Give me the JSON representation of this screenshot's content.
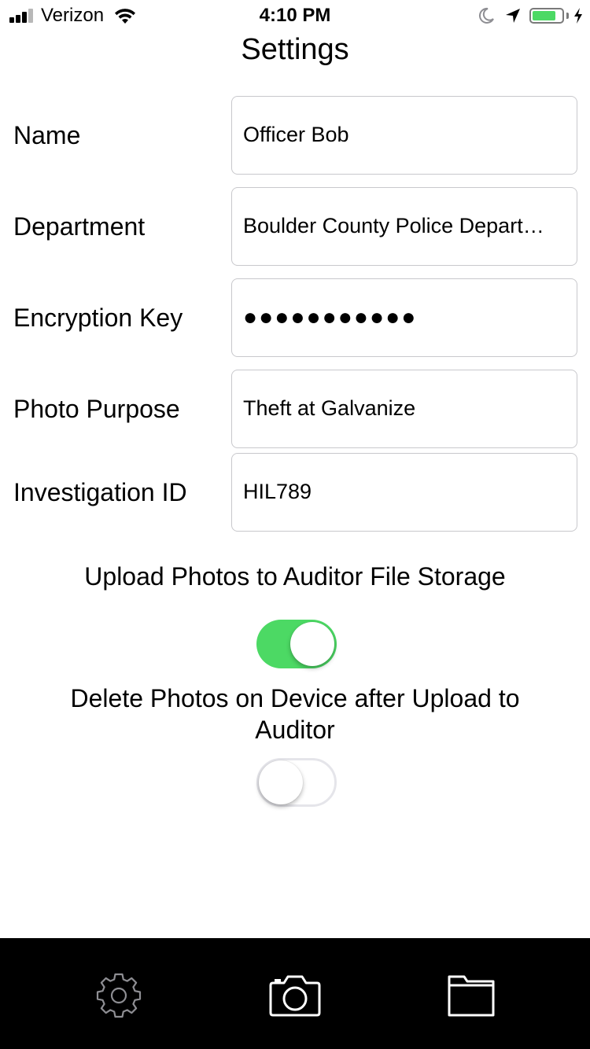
{
  "status_bar": {
    "carrier": "Verizon",
    "time": "4:10 PM",
    "battery_level": 0.9,
    "icons": [
      "signal-icon",
      "wifi-icon",
      "moon-icon",
      "location-arrow-icon",
      "battery-icon",
      "charging-bolt-icon"
    ]
  },
  "nav": {
    "title": "Settings"
  },
  "form": {
    "name": {
      "label": "Name",
      "value": "Officer Bob"
    },
    "department": {
      "label": "Department",
      "value": "Boulder County Police Depart…"
    },
    "encryption_key": {
      "label": "Encryption Key",
      "value": "●●●●●●●●●●●"
    },
    "photo_purpose": {
      "label": "Photo Purpose",
      "value": "Theft at Galvanize"
    },
    "investigation_id": {
      "label": "Investigation ID",
      "value": "HIL789"
    }
  },
  "toggles": {
    "upload": {
      "label": "Upload Photos to Auditor File Storage",
      "on": true
    },
    "delete": {
      "label": "Delete Photos on Device after Upload to Auditor",
      "on": false
    }
  },
  "colors": {
    "switch_on": "#4cd964",
    "tab_bar": "#000000",
    "tab_active": "#ffffff",
    "tab_inactive": "#8e8e93"
  },
  "tab_bar": {
    "tabs": [
      {
        "name": "settings",
        "icon": "gear-icon",
        "active": false
      },
      {
        "name": "camera",
        "icon": "camera-icon",
        "active": true
      },
      {
        "name": "files",
        "icon": "folder-icon",
        "active": true
      }
    ]
  }
}
